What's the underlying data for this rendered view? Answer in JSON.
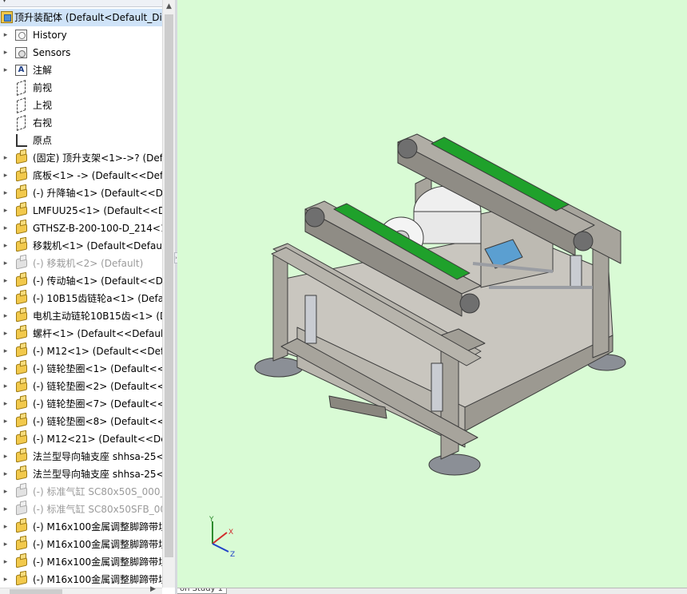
{
  "tree": {
    "root_label": "顶升装配体 (Default<Default_Dis",
    "rows": [
      {
        "label": "History",
        "icon": "history-icon"
      },
      {
        "label": "Sensors",
        "icon": "sensors-icon"
      },
      {
        "label": "注解",
        "icon": "annotations-icon"
      },
      {
        "label": "前视",
        "icon": "plane-icon"
      },
      {
        "label": "上视",
        "icon": "plane-icon"
      },
      {
        "label": "右视",
        "icon": "plane-icon"
      },
      {
        "label": "原点",
        "icon": "origin-icon"
      },
      {
        "label": "(固定) 顶升支架<1>->? (Defa",
        "icon": "part-icon"
      },
      {
        "label": "底板<1> -> (Default<<Defa",
        "icon": "part-icon"
      },
      {
        "label": "(-) 升降轴<1> (Default<<De",
        "icon": "part-icon"
      },
      {
        "label": "LMFUU25<1> (Default<<De",
        "icon": "part-icon"
      },
      {
        "label": "GTHSZ-B-200-100-D_214<1",
        "icon": "part-icon"
      },
      {
        "label": "移栽机<1> (Default<Default_",
        "icon": "part-icon"
      },
      {
        "label": "(-) 移栽机<2> (Default)",
        "icon": "part-icon",
        "muted": true
      },
      {
        "label": "(-) 传动轴<1> (Default<<De",
        "icon": "part-icon"
      },
      {
        "label": "(-) 10B15齿链轮a<1> (Defau",
        "icon": "part-icon"
      },
      {
        "label": "电机主动链轮10B15齿<1> (D",
        "icon": "part-icon"
      },
      {
        "label": "螺杆<1> (Default<<Default>",
        "icon": "part-icon"
      },
      {
        "label": "(-) M12<1> (Default<<Defa",
        "icon": "part-icon"
      },
      {
        "label": "(-) 链轮垫圈<1> (Default<<D",
        "icon": "part-icon"
      },
      {
        "label": "(-) 链轮垫圈<2> (Default<<D",
        "icon": "part-icon"
      },
      {
        "label": "(-) 链轮垫圈<7> (Default<<D",
        "icon": "part-icon"
      },
      {
        "label": "(-) 链轮垫圈<8> (Default<<D",
        "icon": "part-icon"
      },
      {
        "label": "(-) M12<21> (Default<<Def",
        "icon": "part-icon"
      },
      {
        "label": "法兰型导向轴支座 shhsa-25<",
        "icon": "part-icon"
      },
      {
        "label": "法兰型导向轴支座 shhsa-25<",
        "icon": "part-icon"
      },
      {
        "label": "(-) 标准气缸 SC80x50S_000_<",
        "icon": "part-icon",
        "muted": true
      },
      {
        "label": "(-) 标准气缸 SC80x50SFB_000",
        "icon": "part-icon",
        "muted": true
      },
      {
        "label": "(-) M16x100金属调整脚蹄带垃",
        "icon": "part-icon"
      },
      {
        "label": "(-) M16x100金属调整脚蹄带垃",
        "icon": "part-icon"
      },
      {
        "label": "(-) M16x100金属调整脚蹄带垃",
        "icon": "part-icon"
      },
      {
        "label": "(-) M16x100金属调整脚蹄带垃",
        "icon": "part-icon"
      }
    ]
  },
  "triad": {
    "y": "Y",
    "x": "X",
    "z": "Z"
  },
  "bottom_tab": "on Study 1",
  "colors": {
    "viewport_bg": "#d9fbd5",
    "frame": "#a7a49c",
    "belt": "#1fa12b",
    "selection": "#cfe3f8"
  }
}
